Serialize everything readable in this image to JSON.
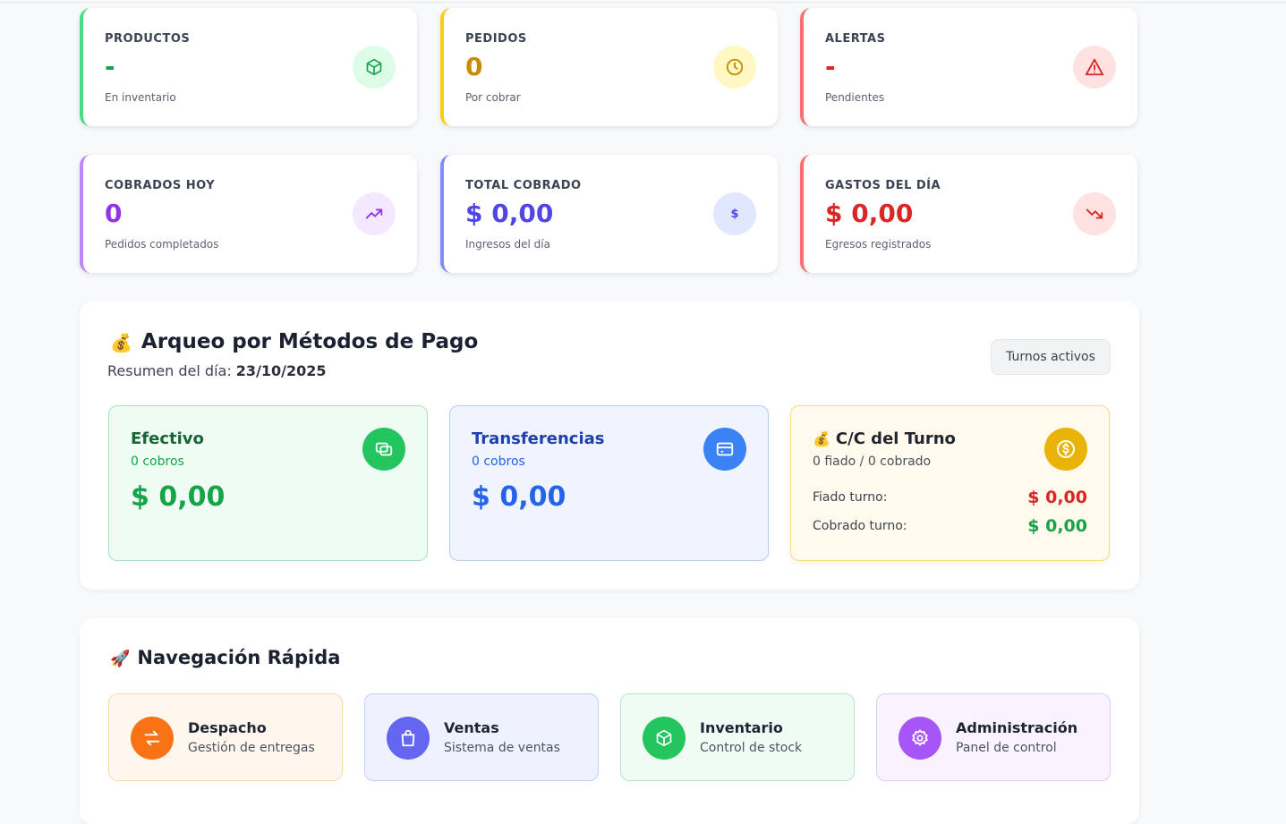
{
  "colors": {
    "green": "#16a34a",
    "amber": "#ca8a04",
    "red": "#dc2626",
    "purple": "#9333ea",
    "indigo": "#4f46e5",
    "blue": "#2563eb"
  },
  "stats": {
    "productos": {
      "title": "PRODUCTOS",
      "value": "-",
      "sub": "En inventario",
      "icon": "box-icon"
    },
    "pedidos": {
      "title": "PEDIDOS",
      "value": "0",
      "sub": "Por cobrar",
      "icon": "clock-icon"
    },
    "alertas": {
      "title": "ALERTAS",
      "value": "-",
      "sub": "Pendientes",
      "icon": "warning-icon"
    },
    "cobrados": {
      "title": "COBRADOS HOY",
      "value": "0",
      "sub": "Pedidos completados",
      "icon": "trending-up-icon"
    },
    "total": {
      "title": "TOTAL COBRADO",
      "value": "$ 0,00",
      "sub": "Ingresos del día",
      "icon": "dollar-icon"
    },
    "gastos": {
      "title": "GASTOS DEL DÍA",
      "value": "$ 0,00",
      "sub": "Egresos registrados",
      "icon": "trending-down-icon"
    }
  },
  "arqueo": {
    "emoji": "💰",
    "title": "Arqueo por Métodos de Pago",
    "subtitle_prefix": "Resumen del día: ",
    "date": "23/10/2025",
    "button": "Turnos activos",
    "efectivo": {
      "title": "Efectivo",
      "count": "0 cobros",
      "amount": "$ 0,00",
      "icon": "cash-icon"
    },
    "transferencias": {
      "title": "Transferencias",
      "count": "0 cobros",
      "amount": "$ 0,00",
      "icon": "credit-card-icon"
    },
    "cc": {
      "emoji": "💰",
      "title": "C/C del Turno",
      "count": "0 fiado / 0 cobrado",
      "icon": "dollar-coin-icon",
      "fiado_label": "Fiado turno:",
      "fiado_value": "$ 0,00",
      "cobrado_label": "Cobrado turno:",
      "cobrado_value": "$ 0,00"
    }
  },
  "nav": {
    "emoji": "🚀",
    "title": "Navegación Rápida",
    "items": [
      {
        "title": "Despacho",
        "sub": "Gestión de entregas",
        "icon": "swap-arrows-icon"
      },
      {
        "title": "Ventas",
        "sub": "Sistema de ventas",
        "icon": "shopping-bag-icon"
      },
      {
        "title": "Inventario",
        "sub": "Control de stock",
        "icon": "box-icon"
      },
      {
        "title": "Administración",
        "sub": "Panel de control",
        "icon": "gear-icon"
      }
    ]
  }
}
